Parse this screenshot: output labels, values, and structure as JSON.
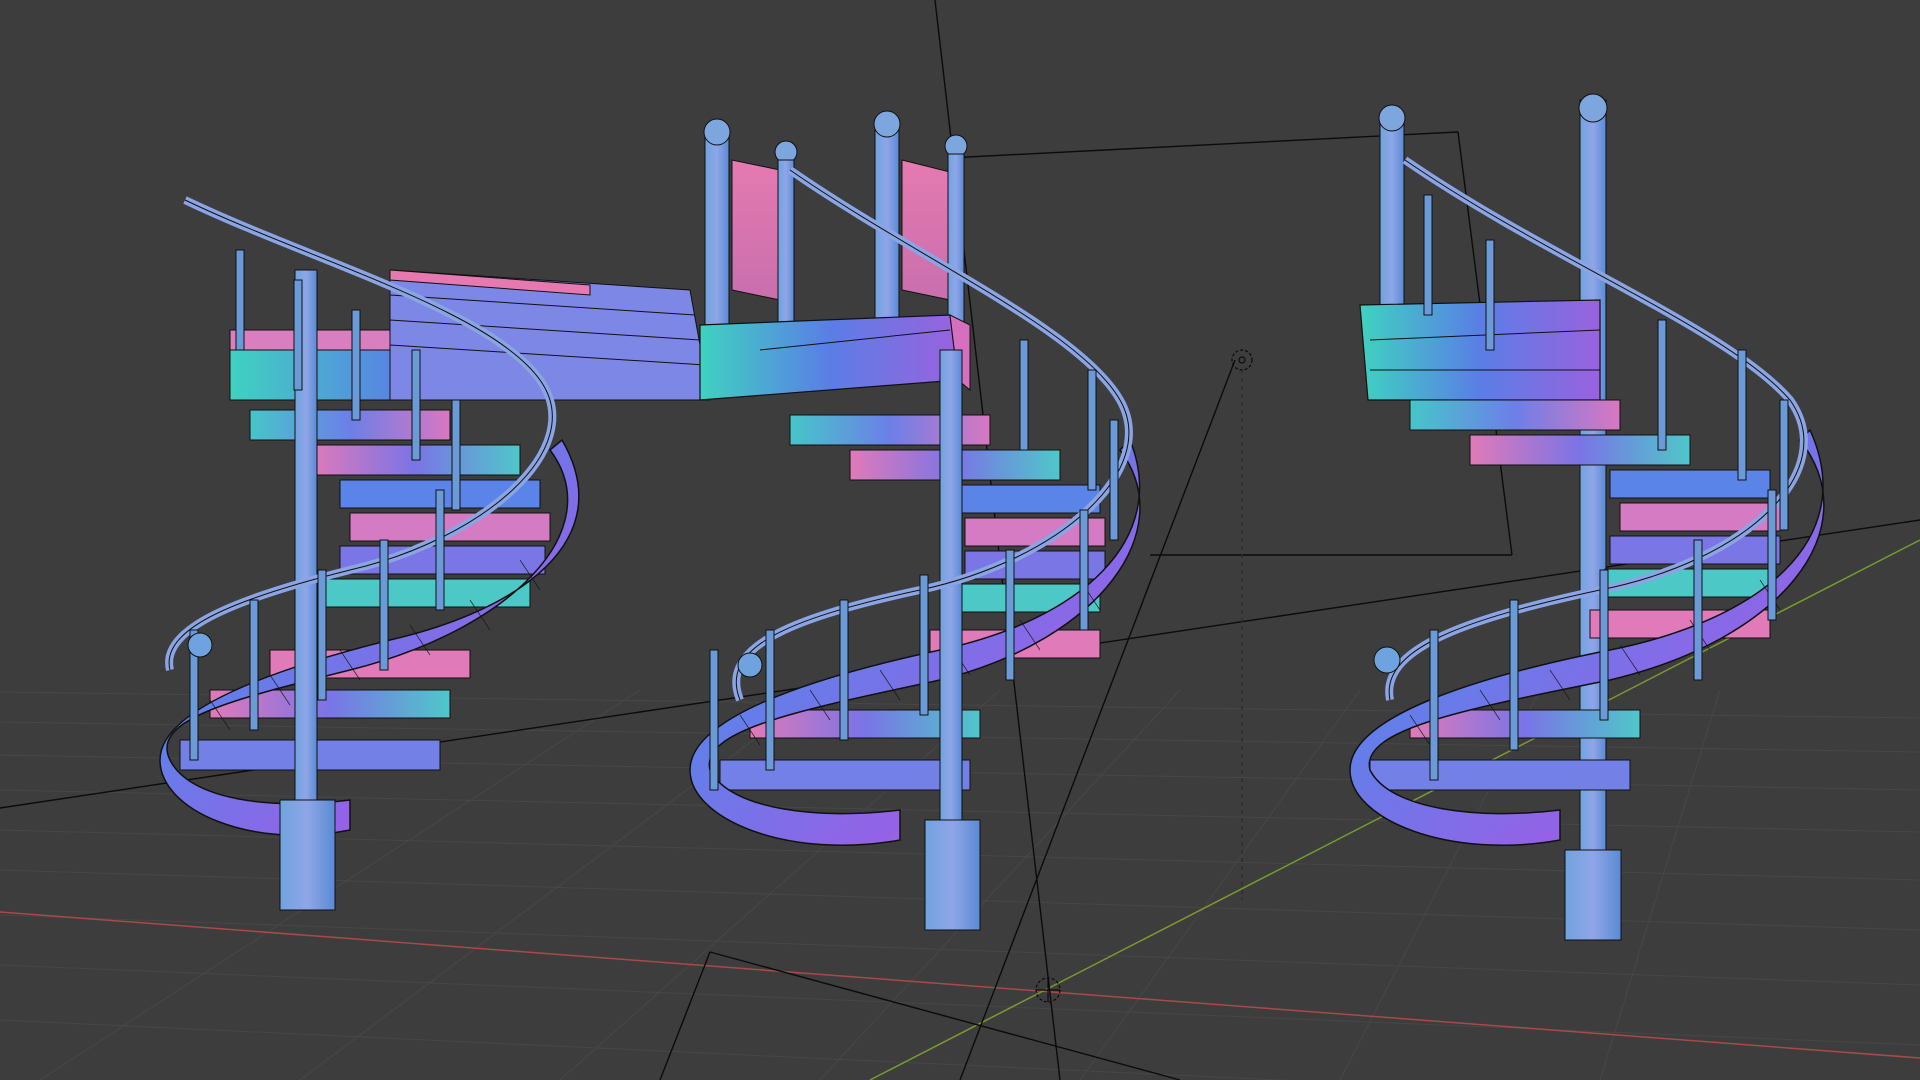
{
  "viewport": {
    "background": "#3d3d3d",
    "grid_color": "#474747",
    "x_axis_color": "#a8494d",
    "y_axis_color": "#7a9a2e",
    "wire_color": "#0b0b0b"
  },
  "objects": [
    {
      "name": "spiral-staircase-left",
      "shading": "normal-map",
      "has_landing": true
    },
    {
      "name": "spiral-staircase-center",
      "shading": "normal-map",
      "has_landing": true
    },
    {
      "name": "spiral-staircase-right",
      "shading": "normal-map",
      "has_landing": true
    }
  ],
  "gizmos": [
    "camera-frustum",
    "light-icon",
    "world-origin"
  ]
}
